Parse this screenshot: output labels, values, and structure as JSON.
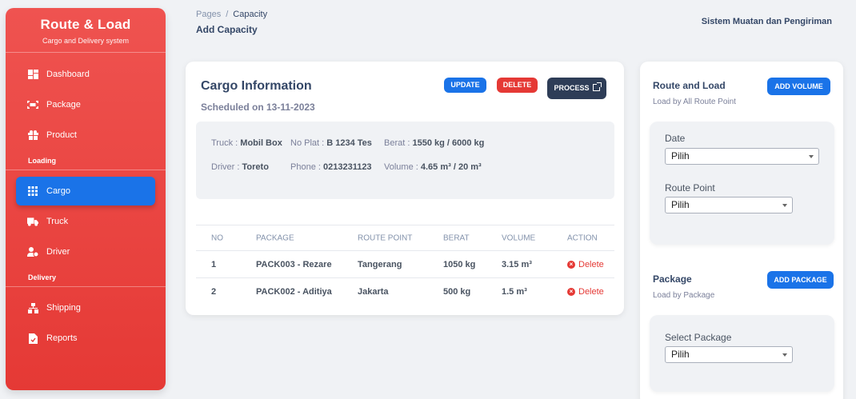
{
  "sidebar": {
    "brand_title": "Route & Load",
    "brand_subtitle": "Cargo and Delivery system",
    "items": [
      {
        "label": "Dashboard",
        "icon": "dashboard-icon"
      },
      {
        "label": "Package",
        "icon": "package-icon"
      },
      {
        "label": "Product",
        "icon": "product-icon"
      }
    ],
    "section_loading": "Loading",
    "loading_items": [
      {
        "label": "Cargo",
        "icon": "grid-icon",
        "active": true
      },
      {
        "label": "Truck",
        "icon": "truck-icon"
      },
      {
        "label": "Driver",
        "icon": "driver-icon"
      }
    ],
    "section_delivery": "Delivery",
    "delivery_items": [
      {
        "label": "Shipping",
        "icon": "shipping-icon"
      },
      {
        "label": "Reports",
        "icon": "reports-icon"
      }
    ]
  },
  "header": {
    "breadcrumb_root": "Pages",
    "breadcrumb_sep": "/",
    "breadcrumb_current": "Capacity",
    "page_title": "Add Capacity",
    "system_name": "Sistem Muatan dan Pengiriman"
  },
  "cargo": {
    "title": "Cargo Information",
    "scheduled": "Scheduled on 13-11-2023",
    "btn_update": "UPDATE",
    "btn_delete": "DELETE",
    "btn_process": "PROCESS",
    "truck_label": "Truck :",
    "truck_value": "Mobil Box",
    "plat_label": "No Plat :",
    "plat_value": "B 1234 Tes",
    "berat_label": "Berat :",
    "berat_value": "1550 kg / 6000 kg",
    "driver_label": "Driver :",
    "driver_value": "Toreto",
    "phone_label": "Phone :",
    "phone_value": "0213231123",
    "volume_label": "Volume :",
    "volume_value": "4.65 m³ / 20 m³"
  },
  "table": {
    "headers": [
      "NO",
      "PACKAGE",
      "ROUTE POINT",
      "BERAT",
      "VOLUME",
      "ACTION"
    ],
    "rows": [
      {
        "no": "1",
        "package": "PACK003 - Rezare",
        "route": "Tangerang",
        "berat": "1050 kg",
        "volume": "3.15 m³",
        "action": "Delete"
      },
      {
        "no": "2",
        "package": "PACK002 - Aditiya",
        "route": "Jakarta",
        "berat": "500 kg",
        "volume": "1.5 m³",
        "action": "Delete"
      }
    ]
  },
  "route_load": {
    "title": "Route and Load",
    "subtitle": "Load by All Route Point",
    "btn_add": "ADD VOLUME",
    "date_label": "Date",
    "date_value": "Pilih",
    "route_label": "Route Point",
    "route_value": "Pilih"
  },
  "package_panel": {
    "title": "Package",
    "subtitle": "Load by Package",
    "btn_add": "ADD PACKAGE",
    "select_label": "Select Package",
    "select_value": "Pilih"
  },
  "colors": {
    "sidebar_red": "#e53935",
    "primary_blue": "#1a73e8",
    "dark_button": "#2e3d57",
    "danger": "#e53935"
  }
}
